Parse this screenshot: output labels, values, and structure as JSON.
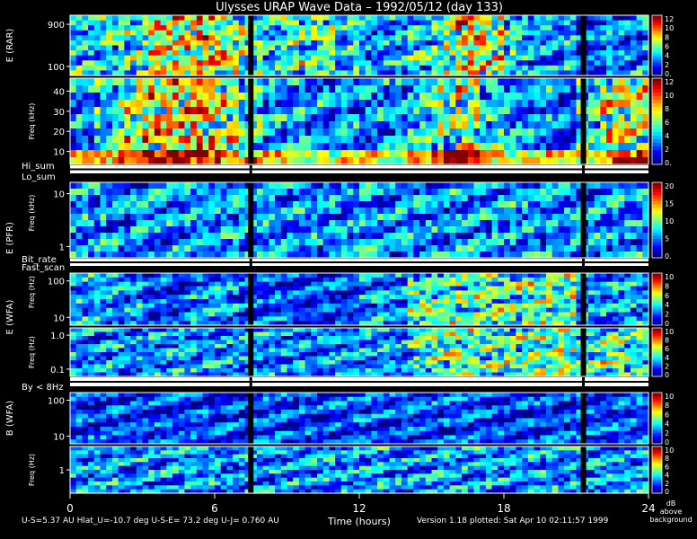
{
  "title": "Ulysses URAP Wave Data  –  1992/05/12  (day 133)",
  "chart_data": {
    "type": "heatmap",
    "x_axis": {
      "label": "Time (hours)",
      "range": [
        0,
        24
      ],
      "ticks": [
        "0",
        "6",
        "12",
        "18",
        "24"
      ]
    },
    "colorbar_caption": [
      "dB",
      "above",
      "background"
    ],
    "data_gap_hours": [
      7.5,
      21.3
    ],
    "strip_labels": [
      {
        "left": "Hi_sum",
        "right": "Lo_sum"
      },
      {
        "left": "Bit_rate",
        "right": "Fast_scan"
      },
      {
        "left": "By < 8Hz",
        "right": ""
      }
    ],
    "panels": [
      {
        "id": "rar-high",
        "ylabel": "E (RAR)",
        "sublabel": "",
        "ylim": [
          60,
          1000
        ],
        "yscale": "log",
        "yticks": [
          "900",
          "100"
        ],
        "cbar_ticks": [
          "12",
          "10",
          "8",
          "6",
          "4",
          "2",
          "0."
        ],
        "activity": [
          0.6,
          0.6,
          0.7,
          0.8,
          0.9,
          0.9,
          0.85,
          0.7,
          0.6,
          0.7,
          0.7,
          0.6,
          0.5,
          0.5,
          0.6,
          0.7,
          0.9,
          0.8,
          0.6,
          0.5,
          0.5,
          0.4,
          0.5,
          0.5
        ]
      },
      {
        "id": "rar-low",
        "ylabel": "",
        "sublabel": "Freq (kHz)",
        "ylim": [
          0,
          50
        ],
        "yscale": "linear",
        "yticks": [
          "40",
          "30",
          "20",
          "10"
        ],
        "cbar_ticks": [
          "12",
          "10",
          "8",
          "6",
          "4",
          "2",
          "0."
        ],
        "activity": [
          0.5,
          0.6,
          0.8,
          0.9,
          0.95,
          0.9,
          0.8,
          0.6,
          0.5,
          0.5,
          0.5,
          0.5,
          0.5,
          0.5,
          0.6,
          0.7,
          0.8,
          0.6,
          0.5,
          0.5,
          0.4,
          0.6,
          0.8,
          0.8
        ]
      },
      {
        "id": "pfr",
        "ylabel": "E (PFR)",
        "sublabel": "Freq (kHz)",
        "ylim": [
          0.6,
          30
        ],
        "yscale": "log",
        "yticks": [
          "10",
          "1"
        ],
        "cbar_ticks": [
          "20",
          "15",
          "10",
          "5",
          "0."
        ],
        "activity": [
          0.5,
          0.5,
          0.5,
          0.5,
          0.5,
          0.5,
          0.5,
          0.5,
          0.5,
          0.5,
          0.5,
          0.5,
          0.5,
          0.5,
          0.5,
          0.5,
          0.5,
          0.5,
          0.5,
          0.5,
          0.5,
          0.5,
          0.5,
          0.5
        ]
      },
      {
        "id": "wfa-e-high",
        "ylabel": "E (WFA)",
        "sublabel": "Freq (Hz)",
        "ylim": [
          8,
          400
        ],
        "yscale": "log",
        "yticks": [
          "100",
          "10"
        ],
        "cbar_ticks": [
          "10",
          "8",
          "6",
          "4",
          "2",
          "0"
        ],
        "activity": [
          0.5,
          0.5,
          0.5,
          0.4,
          0.4,
          0.5,
          0.5,
          0.4,
          0.4,
          0.4,
          0.4,
          0.4,
          0.5,
          0.5,
          0.7,
          0.7,
          0.7,
          0.7,
          0.7,
          0.7,
          0.7,
          0.5,
          0.5,
          0.5
        ]
      },
      {
        "id": "wfa-e-low",
        "ylabel": "",
        "sublabel": "Freq (Hz)",
        "ylim": [
          0.08,
          4
        ],
        "yscale": "log",
        "yticks": [
          "1.0",
          "0.1"
        ],
        "cbar_ticks": [
          "10",
          "8",
          "6",
          "4",
          "2",
          "0"
        ],
        "activity": [
          0.5,
          0.5,
          0.5,
          0.5,
          0.5,
          0.5,
          0.5,
          0.5,
          0.5,
          0.5,
          0.5,
          0.5,
          0.5,
          0.5,
          0.6,
          0.7,
          0.7,
          0.7,
          0.7,
          0.7,
          0.7,
          0.7,
          0.7,
          0.6
        ]
      },
      {
        "id": "wfa-b-high",
        "ylabel": "B (WFA)",
        "sublabel": "",
        "ylim": [
          8,
          400
        ],
        "yscale": "log",
        "yticks": [
          "100",
          "10"
        ],
        "cbar_ticks": [
          "10",
          "8",
          "6",
          "4",
          "2",
          "0"
        ],
        "activity": [
          0.4,
          0.4,
          0.4,
          0.4,
          0.4,
          0.4,
          0.4,
          0.4,
          0.4,
          0.4,
          0.4,
          0.4,
          0.4,
          0.4,
          0.4,
          0.4,
          0.4,
          0.4,
          0.4,
          0.4,
          0.4,
          0.4,
          0.4,
          0.4
        ]
      },
      {
        "id": "wfa-b-low",
        "ylabel": "",
        "sublabel": "Freq (Hz)",
        "ylim": [
          0.08,
          4
        ],
        "yscale": "log",
        "yticks": [
          "1"
        ],
        "cbar_ticks": [
          "10",
          "8",
          "6",
          "4",
          "2",
          "0"
        ],
        "activity": [
          0.5,
          0.5,
          0.5,
          0.5,
          0.5,
          0.5,
          0.5,
          0.5,
          0.5,
          0.5,
          0.5,
          0.5,
          0.5,
          0.5,
          0.5,
          0.5,
          0.5,
          0.5,
          0.5,
          0.5,
          0.5,
          0.5,
          0.5,
          0.5
        ]
      }
    ]
  },
  "footer": {
    "orbit_info": "U-S=5.37 AU   Hlat_U=-10.7 deg   U-S-E= 73.2 deg   U-J= 0.760 AU",
    "version": "Version 1.18 plotted: Sat Apr 10 02:11:57 1999"
  }
}
